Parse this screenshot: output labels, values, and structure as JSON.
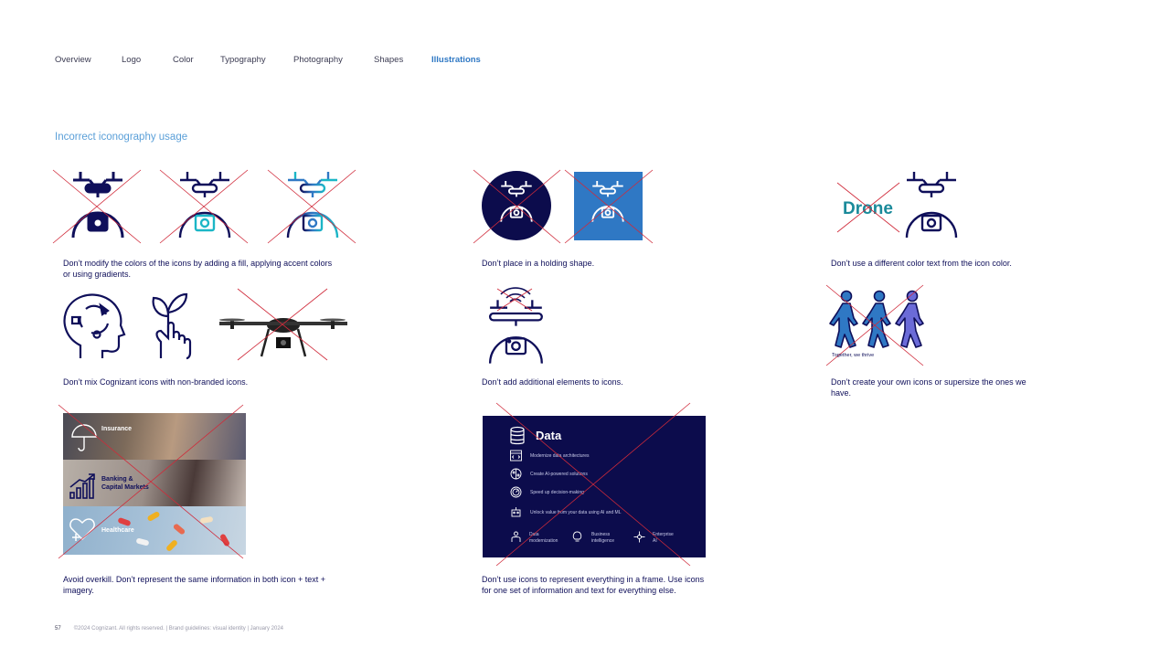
{
  "nav": {
    "items": [
      {
        "label": "Overview"
      },
      {
        "label": "Logo"
      },
      {
        "label": "Color"
      },
      {
        "label": "Typography"
      },
      {
        "label": "Photography"
      },
      {
        "label": "Shapes"
      },
      {
        "label": "Illustrations"
      }
    ],
    "active_index": 6
  },
  "section_title": "Incorrect iconography usage",
  "captions": {
    "fill": "Don’t modify the colors of the icons by adding a fill, applying accent colors or using gradients.",
    "shape": "Don’t place in a holding shape.",
    "textcolor": "Don’t use a different color text from the icon color.",
    "mix": "Don’t mix Cognizant icons with non-branded icons.",
    "elements": "Don’t add additional elements to icons.",
    "create": "Don’t create your own icons or supersize the ones we have.",
    "overkill": "Avoid overkill. Don’t represent the same information in both icon + text + imagery.",
    "frame": "Don’t use icons to represent everything in a frame. Use icons for one set of information and text for everything else."
  },
  "drone_word": "Drone",
  "together_label": "Together, we thrive",
  "photo_labels": [
    "Insurance",
    "Banking &",
    "Capital Markets",
    "Healthcare"
  ],
  "frame": {
    "title": "Data",
    "lines": [
      "Modernize data architectures",
      "Create AI-powered solutions",
      "Speed up decision-making",
      "Unlock value from your data using AI and ML"
    ],
    "bottom": [
      {
        "l1": "Data",
        "l2": "modernization"
      },
      {
        "l1": "Business",
        "l2": "intelligence"
      },
      {
        "l1": "Enterprise",
        "l2": "AI"
      }
    ]
  },
  "footer": {
    "page": "57",
    "text": "©2024 Cognizant. All rights reserved.   |   Brand guidelines: visual identity   |   January 2024"
  },
  "colors": {
    "navy": "#0f0f5a",
    "accent_blue": "#2f78c4",
    "teal": "#1bb6c6",
    "cross_red": "#d02a3a",
    "drone_word": "#1a8a9a",
    "frame_bg": "#0c0c4c"
  },
  "icons": [
    "drone-icon",
    "head-cycle-icon",
    "hand-plant-icon",
    "photo-drone-icon",
    "walking-people-icon",
    "database-icon"
  ]
}
